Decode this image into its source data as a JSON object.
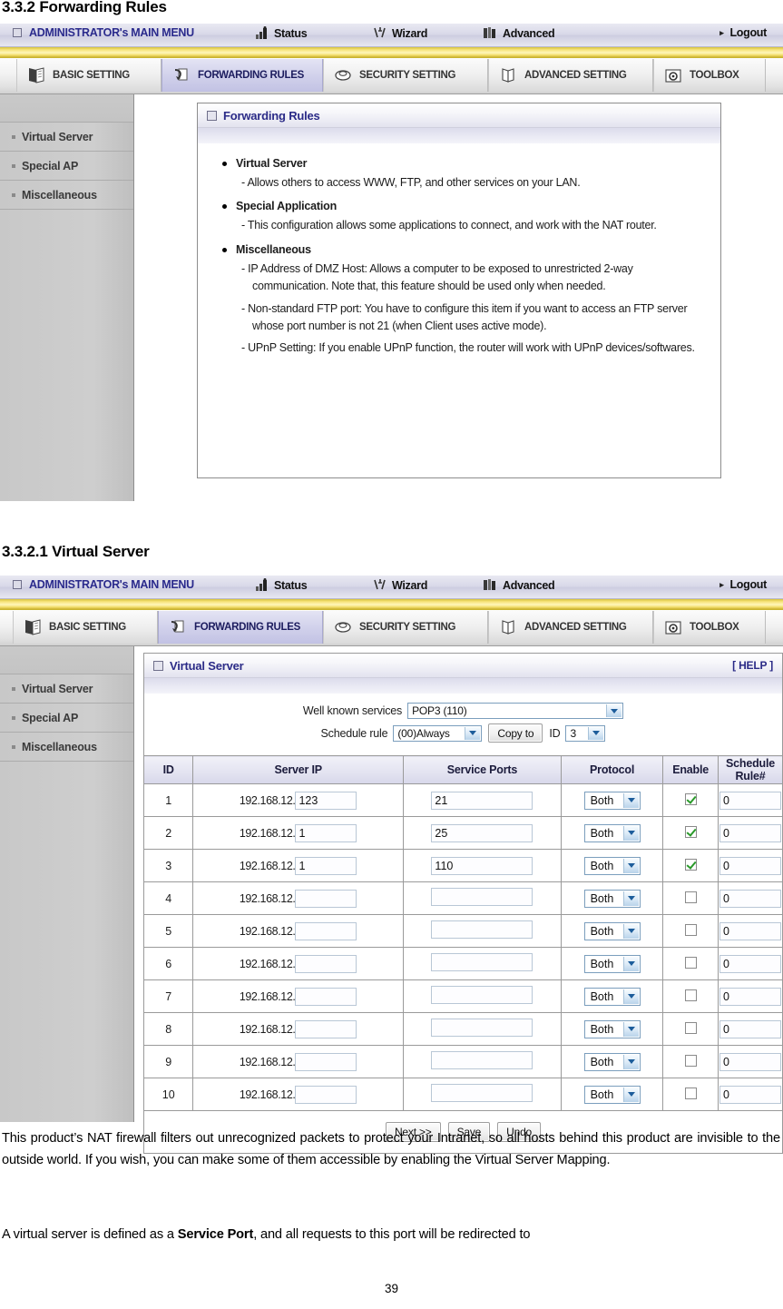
{
  "document": {
    "heading_1": "3.3.2 Forwarding Rules",
    "heading_2": "3.3.2.1 Virtual Server",
    "paragraph_1": "This product’s NAT firewall filters out unrecognized packets to protect your Intranet, so all hosts behind this product are invisible to the outside world. If you wish, you can make some of them accessible by enabling the Virtual Server Mapping.",
    "paragraph_2_pre": "A virtual server is defined as a ",
    "paragraph_2_bold": "Service Port",
    "paragraph_2_post": ", and all requests to this port will be redirected to",
    "page_number": "39"
  },
  "topbar": {
    "admin_menu": "ADMINISTRATOR's MAIN MENU",
    "status": "Status",
    "wizard": "Wizard",
    "advanced": "Advanced",
    "logout": "Logout"
  },
  "tabs": [
    {
      "label": "BASIC SETTING",
      "icon": "book-icon",
      "active": false
    },
    {
      "label": "FORWARDING RULES",
      "icon": "arrow-pages-icon",
      "active": true
    },
    {
      "label": "SECURITY SETTING",
      "icon": "shield-icon",
      "active": false
    },
    {
      "label": "ADVANCED SETTING",
      "icon": "open-book-icon",
      "active": false
    },
    {
      "label": "TOOLBOX",
      "icon": "gear-toolbox-icon",
      "active": false
    }
  ],
  "sidebar": {
    "items": [
      {
        "label": "Virtual Server"
      },
      {
        "label": "Special AP"
      },
      {
        "label": "Miscellaneous"
      }
    ]
  },
  "forwarding_rules_card": {
    "title": "Forwarding Rules",
    "sections": [
      {
        "title": "Virtual Server",
        "lines": [
          "- Allows others to access WWW, FTP, and other services on your LAN."
        ]
      },
      {
        "title": "Special Application",
        "lines": [
          "- This configuration allows some applications to connect, and work with the NAT router."
        ]
      },
      {
        "title": "Miscellaneous",
        "lines": [
          "- IP Address of DMZ Host: Allows a computer to be exposed to unrestricted 2-way communication. Note that, this feature should be used only when needed.",
          "- Non-standard FTP port: You have to configure this item if you want to access an FTP server whose port number is not 21 (when Client uses active mode).",
          "- UPnP Setting: If you enable UPnP function, the router will work with UPnP devices/softwares."
        ]
      }
    ]
  },
  "virtual_server": {
    "title": "Virtual Server",
    "help_label": "[ HELP ]",
    "well_known_services_label": "Well known services",
    "well_known_services_value": "POP3 (110)",
    "schedule_rule_label": "Schedule rule",
    "schedule_rule_value": "(00)Always",
    "copy_to_label": "Copy to",
    "id_label": "ID",
    "id_value": "3",
    "ip_prefix": "192.168.12.",
    "columns": [
      "ID",
      "Server IP",
      "Service Ports",
      "Protocol",
      "Enable",
      "Schedule Rule#"
    ],
    "rows": [
      {
        "id": "1",
        "ip_suffix": "123",
        "ports": "21",
        "protocol": "Both",
        "enable": true,
        "schedule": "0"
      },
      {
        "id": "2",
        "ip_suffix": "1",
        "ports": "25",
        "protocol": "Both",
        "enable": true,
        "schedule": "0"
      },
      {
        "id": "3",
        "ip_suffix": "1",
        "ports": "110",
        "protocol": "Both",
        "enable": true,
        "schedule": "0"
      },
      {
        "id": "4",
        "ip_suffix": "",
        "ports": "",
        "protocol": "Both",
        "enable": false,
        "schedule": "0"
      },
      {
        "id": "5",
        "ip_suffix": "",
        "ports": "",
        "protocol": "Both",
        "enable": false,
        "schedule": "0"
      },
      {
        "id": "6",
        "ip_suffix": "",
        "ports": "",
        "protocol": "Both",
        "enable": false,
        "schedule": "0"
      },
      {
        "id": "7",
        "ip_suffix": "",
        "ports": "",
        "protocol": "Both",
        "enable": false,
        "schedule": "0"
      },
      {
        "id": "8",
        "ip_suffix": "",
        "ports": "",
        "protocol": "Both",
        "enable": false,
        "schedule": "0"
      },
      {
        "id": "9",
        "ip_suffix": "",
        "ports": "",
        "protocol": "Both",
        "enable": false,
        "schedule": "0"
      },
      {
        "id": "10",
        "ip_suffix": "",
        "ports": "",
        "protocol": "Both",
        "enable": false,
        "schedule": "0"
      }
    ],
    "buttons": [
      {
        "label": "Next >>",
        "name": "next-button"
      },
      {
        "label": "Save",
        "name": "save-button"
      },
      {
        "label": "Undo",
        "name": "undo-button"
      }
    ]
  },
  "colors": {
    "accent_blue": "#2b2b87",
    "yellow_band": "#f6e37a",
    "active_tab": "#c2c2e4",
    "sidebar": "#c8c8c8",
    "checkbox_check": "#2a9a2a"
  }
}
